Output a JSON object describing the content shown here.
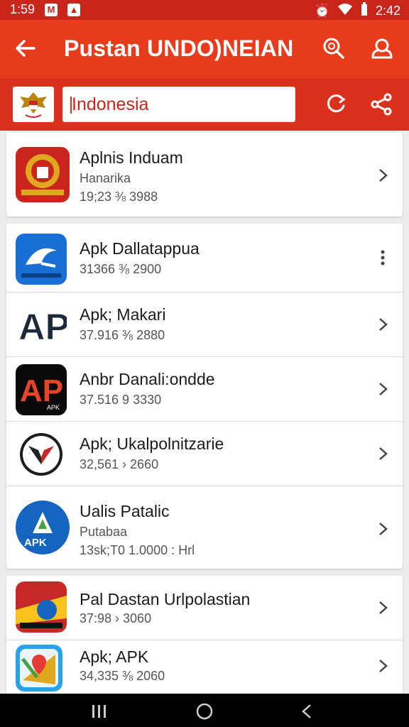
{
  "status": {
    "time_left": "1:59",
    "time_right": "2:42",
    "left_icons": [
      "M",
      "image-icon"
    ]
  },
  "appbar": {
    "title": "Pustan UNDO)NEIAN"
  },
  "search": {
    "value": "Indonesia",
    "placeholder": ""
  },
  "cards": [
    {
      "rows": [
        {
          "name": "Aplnis Induam",
          "sub": "Hanarika",
          "meta": "19;23 ⅜ 3988",
          "action": "chevron"
        }
      ]
    },
    {
      "rows": [
        {
          "name": "Apk Dallatappua",
          "meta": "31366 ⅜ 2900",
          "action": "more"
        },
        {
          "name": "Apk; Makari",
          "meta": "37.916 ⅜ 2880",
          "action": "chevron"
        },
        {
          "name": "Anbr Danali:ondde",
          "meta": "37.516  9 3330",
          "action": "chevron"
        },
        {
          "name": "Apk; Ukalpolnitzarie",
          "meta": "32,561  › 2660",
          "action": "chevron"
        },
        {
          "name": "Ualis Patalic",
          "sub": "Putabaa",
          "meta": "13sk;T0 1.0000 : Hrl",
          "action": "chevron"
        }
      ]
    },
    {
      "rows": [
        {
          "name": "Pal Dastan Urlpolastian",
          "meta": "37:98  › 3060",
          "action": "chevron"
        },
        {
          "name": "Apk; APK",
          "meta": "34,335 ⅜ 2060",
          "action": "chevron"
        }
      ]
    }
  ],
  "icon_labels": {
    "ap": "AP",
    "apk": "APK",
    "apk_small": "APK"
  },
  "colors": {
    "appbar": "#e63c1c",
    "status": "#c9261b",
    "accent_text": "#c9261b"
  }
}
